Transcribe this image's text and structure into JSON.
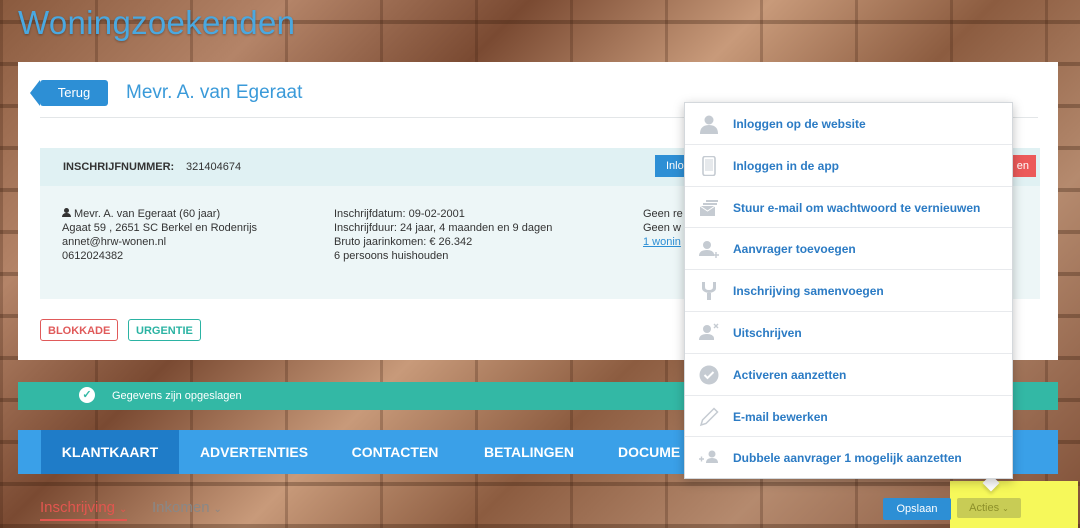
{
  "app": {
    "title": "Woningzoekenden"
  },
  "header": {
    "back_label": "Terug",
    "client_name": "Mevr. A. van Egeraat"
  },
  "registration": {
    "label": "INSCHRIJFNUMMER:",
    "number": "321404674"
  },
  "info": {
    "col1": [
      "Mevr. A. van Egeraat (60 jaar)",
      "Agaat 59 , 2651 SC Berkel en Rodenrijs",
      "annet@hrw-wonen.nl",
      "0612024382"
    ],
    "col2": [
      "Inschrijfdatum: 09-02-2001",
      "Inschrijfduur: 24 jaar, 4 maanden en 9 dagen",
      "Bruto jaarinkomen: € 26.342",
      "6 persoons huishouden"
    ],
    "col3": [
      "Geen re",
      "Geen w",
      "1 wonin"
    ]
  },
  "partial_buttons": {
    "blue": "Inlo",
    "red": "en"
  },
  "tags": {
    "blokkade": "BLOKKADE",
    "urgentie": "URGENTIE"
  },
  "notification": {
    "text": "Gegevens zijn opgeslagen"
  },
  "tabs": [
    "KLANTKAART",
    "ADVERTENTIES",
    "CONTACTEN",
    "BETALINGEN",
    "DOCUME"
  ],
  "subtabs": {
    "active": "Inschrijving",
    "inactive": "Inkomen"
  },
  "actions": {
    "save_label": "Opslaan",
    "acties_label": "Acties"
  },
  "menu": {
    "items": [
      {
        "label": "Inloggen op de website",
        "icon": "user-icon"
      },
      {
        "label": "Inloggen in de app",
        "icon": "phone-icon"
      },
      {
        "label": "Stuur e-mail om wachtwoord te vernieuwen",
        "icon": "mail-stack-icon"
      },
      {
        "label": "Aanvrager toevoegen",
        "icon": "user-add-icon"
      },
      {
        "label": "Inschrijving samenvoegen",
        "icon": "merge-icon"
      },
      {
        "label": "Uitschrijven",
        "icon": "user-remove-icon"
      },
      {
        "label": "Activeren aanzetten",
        "icon": "check-circle-icon"
      },
      {
        "label": "E-mail bewerken",
        "icon": "pencil-icon"
      },
      {
        "label": "Dubbele aanvrager 1 mogelijk aanzetten",
        "icon": "duplicate-user-icon"
      }
    ]
  },
  "colors": {
    "accent": "#2d8fd5",
    "teal": "#33b8a5",
    "red": "#e2564f",
    "highlight": "#f6f85a"
  }
}
